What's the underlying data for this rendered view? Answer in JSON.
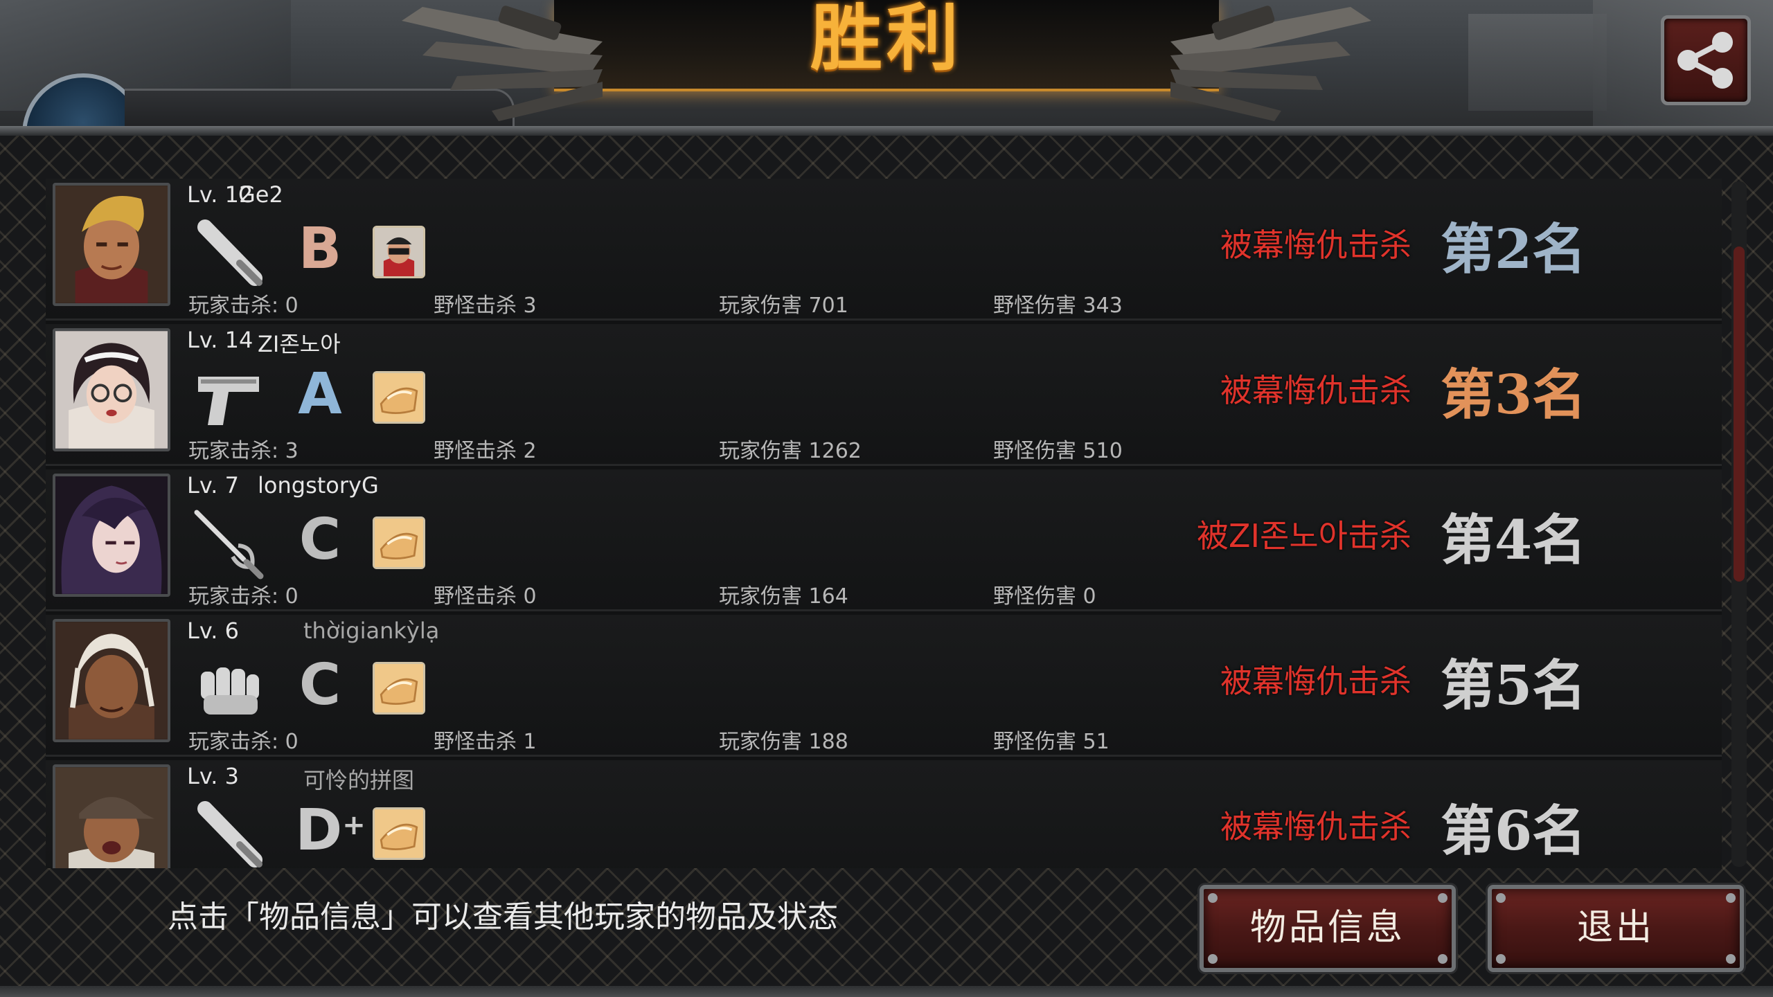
{
  "header": {
    "title": "胜利",
    "share_icon": "share-icon"
  },
  "colors": {
    "title_gold": "#f7b23a",
    "killer_red": "#e0332b",
    "rank_silver": "#9fb4c8",
    "rank_bronze": "#e2925a",
    "rank_gray": "#cfcfcf",
    "button_red": "#5a1c1a"
  },
  "results": [
    {
      "level": "Lv. 12",
      "name": "Ge2",
      "weapon_icon": "baseball-bat-icon",
      "grade": "B",
      "grade_suffix": "",
      "item_icon": "character-portrait-icon",
      "stats": [
        "玩家击杀: 0",
        "野怪击杀 3",
        "玩家伤害 701",
        "野怪伤害 343"
      ],
      "killed_by": "被幕悔仇击杀",
      "rank": "第2名"
    },
    {
      "level": "Lv. 14",
      "name": "ZI존노아",
      "weapon_icon": "pistol-icon",
      "grade": "A",
      "grade_suffix": "",
      "item_icon": "bread-box-icon",
      "stats": [
        "玩家击杀: 3",
        "野怪击杀 2",
        "玩家伤害 1262",
        "野怪伤害 510"
      ],
      "killed_by": "被幕悔仇击杀",
      "rank": "第3名"
    },
    {
      "level": "Lv. 7",
      "name": "longstoryG",
      "weapon_icon": "rapier-icon",
      "grade": "C",
      "grade_suffix": "",
      "item_icon": "bread-box-icon",
      "stats": [
        "玩家击杀: 0",
        "野怪击杀 0",
        "玩家伤害 164",
        "野怪伤害 0"
      ],
      "killed_by": "被ZI존노아击杀",
      "rank": "第4名"
    },
    {
      "level": "Lv. 6",
      "name": "thờigiankỳlạ",
      "weapon_icon": "fist-icon",
      "grade": "C",
      "grade_suffix": "",
      "item_icon": "bread-box-icon",
      "stats": [
        "玩家击杀: 0",
        "野怪击杀 1",
        "玩家伤害 188",
        "野怪伤害 51"
      ],
      "killed_by": "被幕悔仇击杀",
      "rank": "第5名"
    },
    {
      "level": "Lv. 3",
      "name": "可怜的拼图",
      "weapon_icon": "baseball-bat-icon",
      "grade": "D",
      "grade_suffix": "+",
      "item_icon": "bread-box-icon",
      "stats": [
        "",
        "",
        "",
        ""
      ],
      "killed_by": "被幕悔仇击杀",
      "rank": "第6名"
    }
  ],
  "footer": {
    "hint": "点击「物品信息」可以查看其他玩家的物品及状态",
    "item_info_button": "物品信息",
    "exit_button": "退出"
  }
}
